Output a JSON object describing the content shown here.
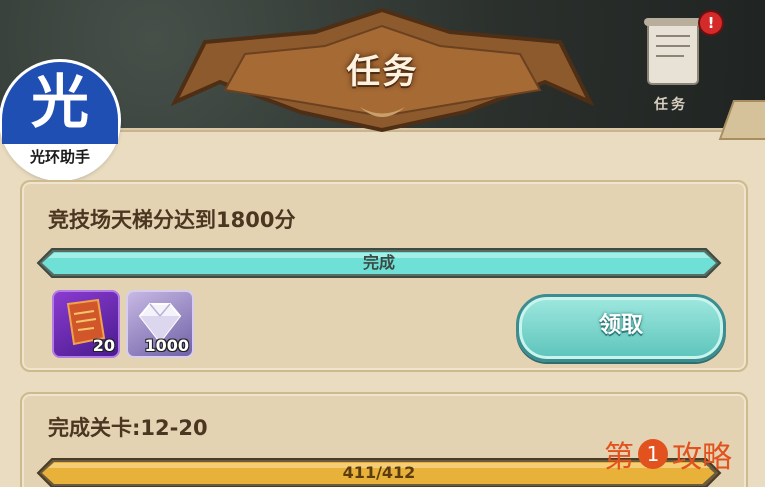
{
  "header": {
    "title": "任务",
    "side_label": "任务",
    "alert_badge": "!"
  },
  "logo": {
    "char": "光",
    "text": "光环助手"
  },
  "tasks": [
    {
      "title": "竞技场天梯分达到1800分",
      "progress_text": "完成",
      "progress_fraction": 1.0,
      "rewards": [
        {
          "icon": "scroll-icon",
          "count": "20"
        },
        {
          "icon": "diamond-icon",
          "count": "1000"
        }
      ],
      "claim_label": "领取"
    },
    {
      "title": "完成关卡:12-20",
      "progress_text": "411/412",
      "progress_fraction": 0.9976
    }
  ],
  "watermark": {
    "prefix": "第",
    "number": "1",
    "suffix": "攻略"
  },
  "colors": {
    "complete_bar": "#6fe0d6",
    "progress_bar": "#e8b23a",
    "claim_button": "#7ad6cc",
    "watermark": "#e2521f"
  }
}
